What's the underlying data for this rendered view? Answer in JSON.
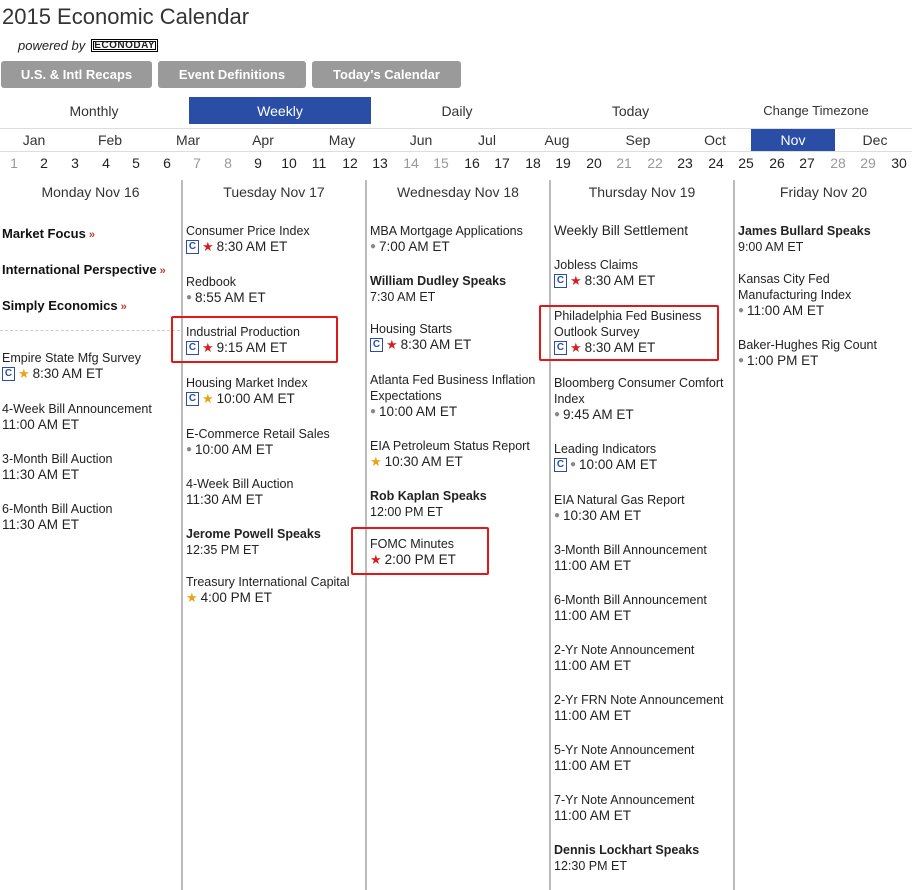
{
  "title": "2015 Economic Calendar",
  "powered_by": "powered by",
  "brand": "ECONODAY",
  "buttons": [
    "U.S. & Intl Recaps",
    "Event Definitions",
    "Today's Calendar"
  ],
  "views": [
    "Monthly",
    "Weekly",
    "Daily",
    "Today",
    "Change Timezone"
  ],
  "months": [
    "Jan",
    "Feb",
    "Mar",
    "Apr",
    "May",
    "Jun",
    "Jul",
    "Aug",
    "Sep",
    "Oct",
    "Nov",
    "Dec"
  ],
  "days": [
    "1",
    "2",
    "3",
    "4",
    "5",
    "6",
    "7",
    "8",
    "9",
    "10",
    "11",
    "12",
    "13",
    "14",
    "15",
    "16",
    "17",
    "18",
    "19",
    "20",
    "21",
    "22",
    "23",
    "24",
    "25",
    "26",
    "27",
    "28",
    "29",
    "30"
  ],
  "columns": {
    "mon": {
      "header": "Monday Nov 16",
      "focus": [
        "Market Focus",
        "International Perspective",
        "Simply Economics"
      ],
      "events": [
        {
          "name": "Empire State Mfg Survey",
          "time": "8:30 AM ET"
        },
        {
          "name": "4-Week Bill Announcement",
          "time": "11:00 AM ET"
        },
        {
          "name": "3-Month Bill Auction",
          "time": "11:30 AM ET"
        },
        {
          "name": "6-Month Bill Auction",
          "time": "11:30 AM ET"
        }
      ]
    },
    "tue": {
      "header": "Tuesday Nov 17",
      "events": [
        {
          "name": "Consumer Price Index",
          "time": "8:30 AM ET"
        },
        {
          "name": "Redbook",
          "time": "8:55 AM ET"
        },
        {
          "name": "Industrial Production",
          "time": "9:15 AM ET"
        },
        {
          "name": "Housing Market Index",
          "time": "10:00 AM ET"
        },
        {
          "name": "E-Commerce Retail Sales",
          "time": "10:00 AM ET"
        },
        {
          "name": "4-Week Bill Auction",
          "time": "11:30 AM ET"
        },
        {
          "name": "Jerome Powell Speaks",
          "time": "12:35 PM ET"
        },
        {
          "name": "Treasury International Capital",
          "time": "4:00 PM ET"
        }
      ]
    },
    "wed": {
      "header": "Wednesday Nov 18",
      "events": [
        {
          "name": "MBA Mortgage Applications",
          "time": "7:00 AM ET"
        },
        {
          "name": "William Dudley Speaks",
          "time": "7:30 AM ET"
        },
        {
          "name": "Housing Starts",
          "time": "8:30 AM ET"
        },
        {
          "name": "Atlanta Fed Business Inflation Expectations",
          "time": "10:00 AM ET"
        },
        {
          "name": "EIA Petroleum Status Report",
          "time": "10:30 AM ET"
        },
        {
          "name": "Rob Kaplan Speaks",
          "time": "12:00 PM ET"
        },
        {
          "name": "FOMC Minutes",
          "time": "2:00 PM ET"
        }
      ]
    },
    "thu": {
      "header": "Thursday Nov 19",
      "events": [
        {
          "name": "Weekly Bill Settlement",
          "time": ""
        },
        {
          "name": "Jobless Claims",
          "time": "8:30 AM ET"
        },
        {
          "name": "Philadelphia Fed Business Outlook Survey",
          "time": "8:30 AM ET"
        },
        {
          "name": "Bloomberg Consumer Comfort Index",
          "time": "9:45 AM ET"
        },
        {
          "name": "Leading Indicators",
          "time": "10:00 AM ET"
        },
        {
          "name": "EIA Natural Gas Report",
          "time": "10:30 AM ET"
        },
        {
          "name": "3-Month Bill Announcement",
          "time": "11:00 AM ET"
        },
        {
          "name": "6-Month Bill Announcement",
          "time": "11:00 AM ET"
        },
        {
          "name": "2-Yr Note Announcement",
          "time": "11:00 AM ET"
        },
        {
          "name": "2-Yr FRN Note Announcement",
          "time": "11:00 AM ET"
        },
        {
          "name": "5-Yr Note Announcement",
          "time": "11:00 AM ET"
        },
        {
          "name": "7-Yr Note Announcement",
          "time": "11:00 AM ET"
        },
        {
          "name": "Dennis Lockhart Speaks",
          "time": "12:30 PM ET"
        }
      ]
    },
    "fri": {
      "header": "Friday Nov 20",
      "events": [
        {
          "name": "James Bullard Speaks",
          "time": "9:00 AM ET"
        },
        {
          "name": "Kansas City Fed Manufacturing Index",
          "time": "11:00 AM ET"
        },
        {
          "name": "Baker-Hughes Rig Count",
          "time": "1:00 PM ET"
        }
      ]
    }
  },
  "icons": {
    "consensus": "C",
    "high_importance": "red-star",
    "medium_importance": "gold-star",
    "bullet": "dot"
  },
  "colors": {
    "accent": "#2a4ea6",
    "button": "#9a9a9a",
    "highlight": "#e01818",
    "star_red": "#d62020",
    "star_gold": "#e8a317"
  }
}
